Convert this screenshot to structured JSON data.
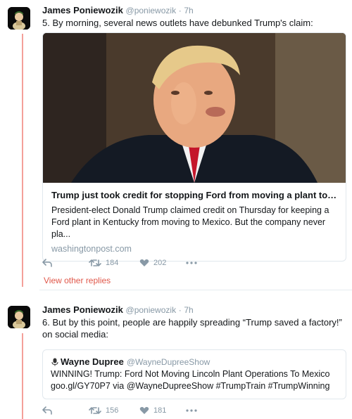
{
  "tweets": [
    {
      "name": "James Poniewozik",
      "handle": "@poniewozik",
      "dot": "·",
      "time": "7h",
      "text": "5. By morning, several news outlets have debunked Trump's claim:",
      "card": {
        "title": "Trump just took credit for stopping Ford from moving a plant to Mexi...",
        "description": "President-elect Donald Trump claimed credit on Thursday for keeping a Ford plant in Kentucky from moving to Mexico. But the company never pla...",
        "domain": "washingtonpost.com"
      },
      "actions": {
        "reply_icon": "reply-icon",
        "retweet_icon": "retweet-icon",
        "retweets": "184",
        "like_icon": "heart-icon",
        "likes": "202",
        "more_icon": "more-icon"
      }
    },
    {
      "name": "James Poniewozik",
      "handle": "@poniewozik",
      "dot": "·",
      "time": "7h",
      "text": "6. But by this point, people are happily spreading “Trump saved a factory!” on social media:",
      "quote": {
        "name": "Wayne Dupree",
        "handle": "@WayneDupreeShow",
        "text": "WINNING! Trump: Ford Not Moving Lincoln Plant Operations To Mexico goo.gl/GY70P7 via @WayneDupreeShow #TrumpTrain #TrumpWinning"
      },
      "actions": {
        "reply_icon": "reply-icon",
        "retweet_icon": "retweet-icon",
        "retweets": "156",
        "like_icon": "heart-icon",
        "likes": "181",
        "more_icon": "more-icon"
      }
    }
  ],
  "view_other_replies": "View other replies",
  "colors": {
    "thread_line": "#f4a09a",
    "link_red": "#e0574a",
    "muted": "#8899a6",
    "border": "#e1e8ed"
  }
}
